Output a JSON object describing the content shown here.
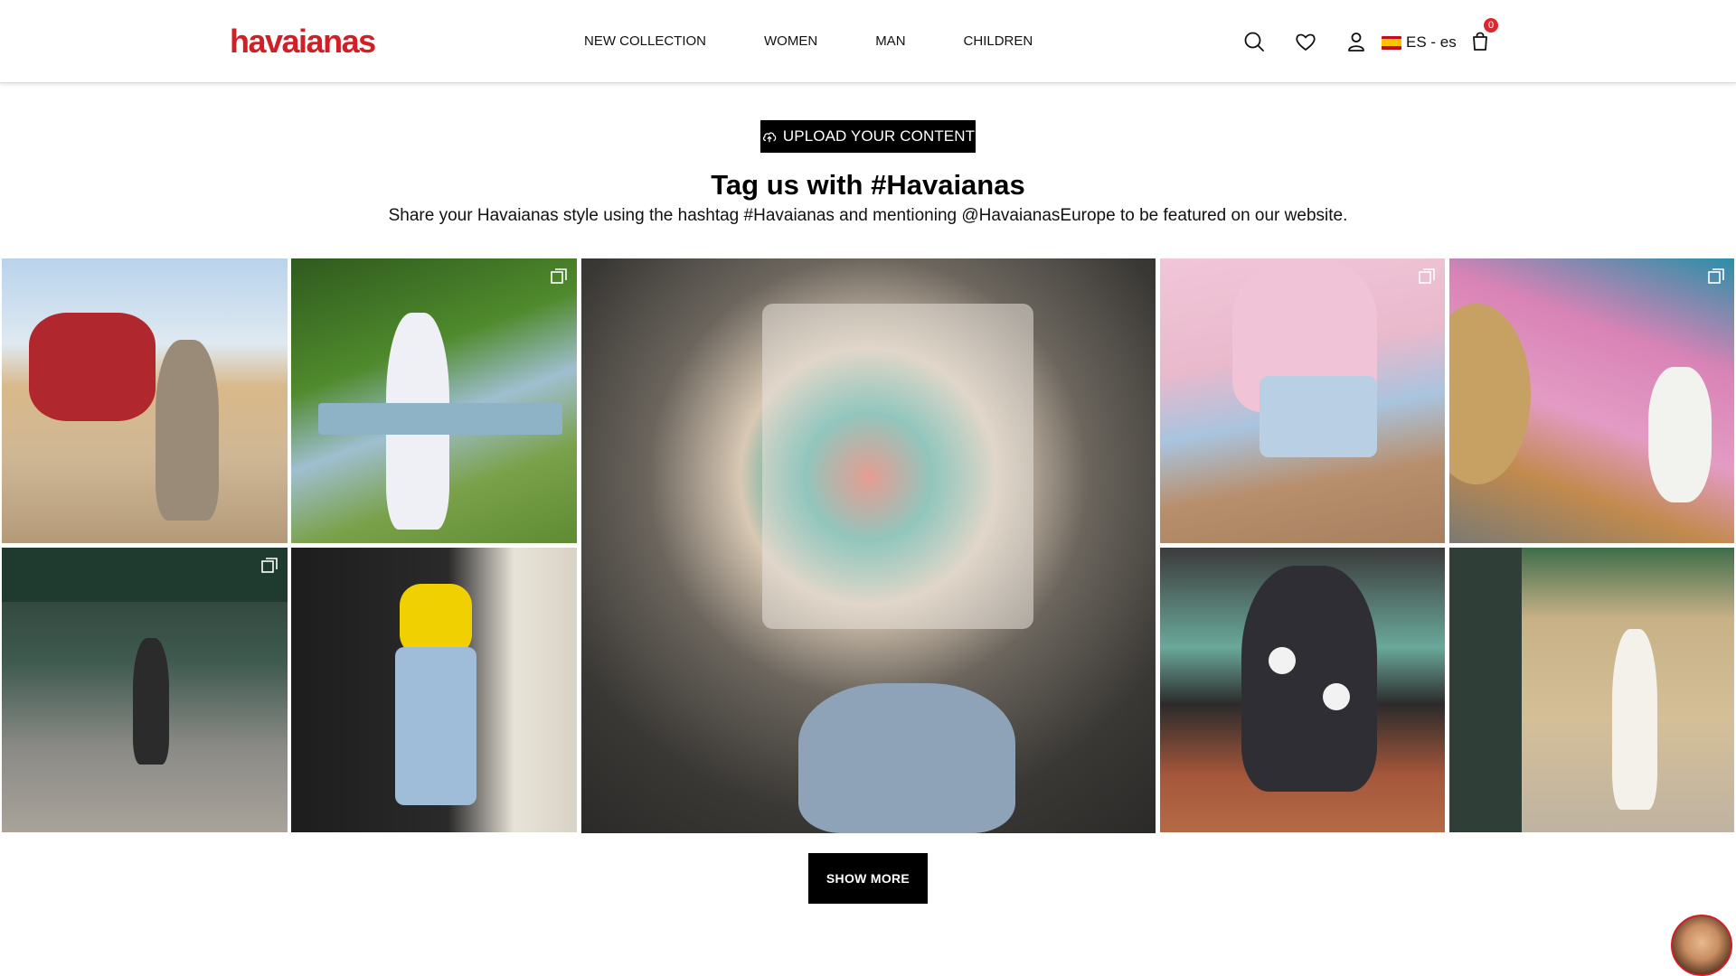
{
  "header": {
    "logo_text": "havaianas",
    "nav": [
      "NEW COLLECTION",
      "WOMEN",
      "MAN",
      "CHILDREN"
    ],
    "icons": [
      "search-icon",
      "heart-icon",
      "user-icon",
      "bag-icon"
    ],
    "language": "ES - es",
    "cart_count": "0"
  },
  "intro": {
    "upload_button": "UPLOAD YOUR CONTENT",
    "title": "Tag us with #Havaianas",
    "subtitle": "Share your Havaianas style using the hashtag #Havaianas and mentioning @HavaianasEurope to be featured on our website."
  },
  "gallery": {
    "show_more": "SHOW MORE"
  },
  "colors": {
    "brand_red": "#d21f26",
    "button_black": "#000000",
    "badge_red": "#e0262d"
  }
}
